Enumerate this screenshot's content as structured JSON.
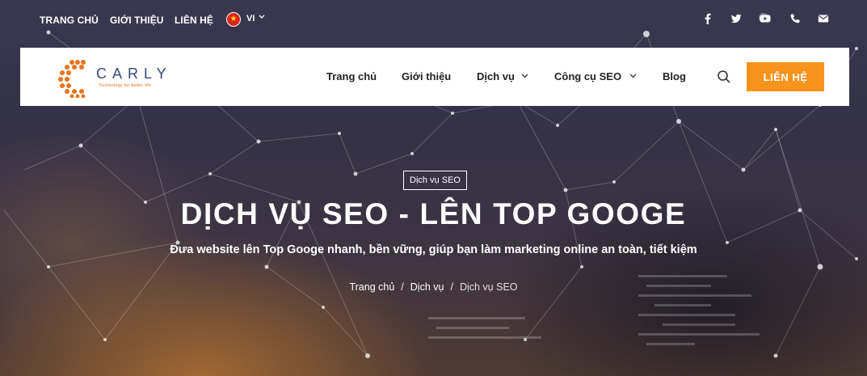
{
  "topbar": {
    "links": [
      "TRANG CHỦ",
      "GIỚI THIỆU",
      "LIÊN HỆ"
    ],
    "language": "VI",
    "social_icons": [
      "facebook-icon",
      "twitter-icon",
      "youtube-icon",
      "phone-icon",
      "mail-icon"
    ]
  },
  "navbar": {
    "logo_text": "CARLY",
    "logo_tagline": "Technology for better life",
    "items": [
      "Trang chủ",
      "Giới thiệu",
      "Dịch vụ",
      "Công cụ SEO",
      "Blog"
    ],
    "contact_label": "LIÊN HỆ"
  },
  "hero": {
    "tag": "Dịch vụ SEO",
    "title": "DỊCH VỤ SEO - LÊN TOP GOOGE",
    "subtitle": "Đưa website lên Top Googe nhanh, bền vững, giúp bạn làm marketing online an toàn, tiết kiệm",
    "breadcrumb": [
      "Trang chủ",
      "Dịch vụ",
      "Dịch vụ SEO"
    ]
  },
  "colors": {
    "accent": "#f7941d",
    "logo_blue": "#3a4a78",
    "logo_orange": "#e8741b",
    "flag_red": "#da251d"
  }
}
